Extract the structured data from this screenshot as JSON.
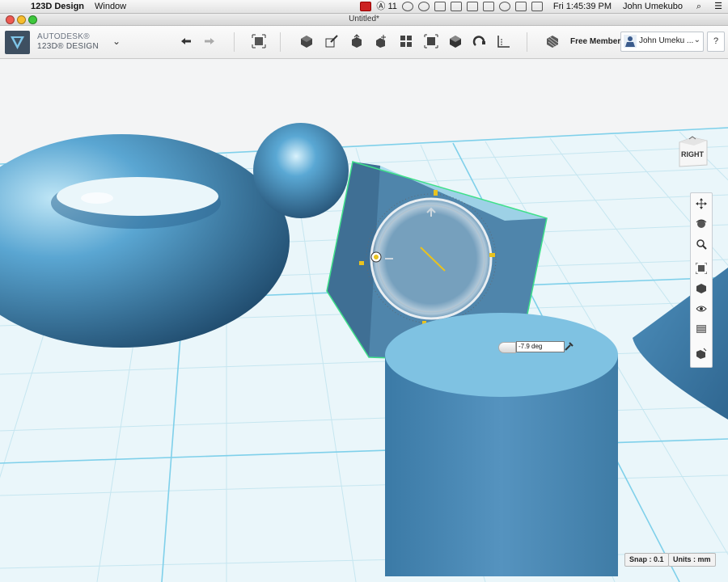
{
  "menubar": {
    "app_name": "123D Design",
    "menu_window": "Window",
    "adobe_count": "11",
    "clock": "Fri 1:45:39 PM",
    "user": "John Umekubo",
    "icons": [
      "apple-icon",
      "record-icon",
      "adobe-icon",
      "skype-icon",
      "sync-icon",
      "dropbox-icon",
      "mirror-icon",
      "eject-icon",
      "bluetooth-icon",
      "wifi-icon",
      "volume-icon",
      "battery-icon",
      "spotlight-icon",
      "notification-icon"
    ]
  },
  "window": {
    "title": "Untitled*"
  },
  "toolbar": {
    "logo_line1": "AUTODESK®",
    "logo_line2": "123D® DESIGN",
    "buttons": [
      "undo",
      "redo",
      "transform",
      "primitives",
      "sketch",
      "construct",
      "modify",
      "pattern",
      "group",
      "combine",
      "measure",
      "snap",
      "text",
      "materials"
    ],
    "free_member": "Free Member",
    "user_name": "John Umeku ...",
    "help": "?"
  },
  "viewcube": {
    "face": "RIGHT"
  },
  "nav_tools": [
    "pan",
    "orbit",
    "zoom",
    "fit",
    "view-style",
    "visibility",
    "materials-view",
    "solid-view"
  ],
  "angle_input": {
    "value": "-7.9 deg"
  },
  "status": {
    "snap": "Snap : 0.1",
    "units": "Units : mm"
  },
  "colors": {
    "object_blue": "#4d93c0",
    "object_dark": "#2d5f86",
    "grid_line": "#bfe3ef",
    "selection_green": "#3fe08a",
    "gizmo_yellow": "#e8c21f"
  }
}
